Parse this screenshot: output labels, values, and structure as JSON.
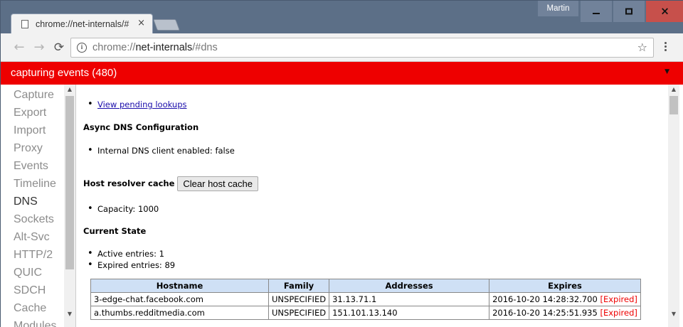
{
  "tab": {
    "title": "chrome://net-internals/#",
    "close": "×"
  },
  "user": "Martin",
  "window_controls": {
    "minimize": "minimize",
    "maximize": "maximize",
    "close": "×"
  },
  "toolbar": {
    "back": "←",
    "forward": "→",
    "reload": "⟳",
    "url_scheme": "chrome://",
    "url_host": "net-internals",
    "url_path": "/#dns",
    "star": "☆"
  },
  "capture_bar": {
    "text": "capturing events (480)",
    "dropdown": "▼"
  },
  "sidebar": {
    "items": [
      "Capture",
      "Export",
      "Import",
      "Proxy",
      "Events",
      "Timeline",
      "DNS",
      "Sockets",
      "Alt-Svc",
      "HTTP/2",
      "QUIC",
      "SDCH",
      "Cache",
      "Modules"
    ],
    "active": "DNS"
  },
  "content": {
    "pending_link": "View pending lookups",
    "async_heading": "Async DNS Configuration",
    "internal_dns": "Internal DNS client enabled: false",
    "host_cache_heading": "Host resolver cache",
    "clear_cache_button": "Clear host cache",
    "capacity": "Capacity: 1000",
    "current_state_heading": "Current State",
    "active_entries": "Active entries: 1",
    "expired_entries": "Expired entries: 89",
    "table": {
      "columns": [
        "Hostname",
        "Family",
        "Addresses",
        "Expires"
      ],
      "rows": [
        {
          "hostname": "3-edge-chat.facebook.com",
          "family": "UNSPECIFIED",
          "addresses": "31.13.71.1",
          "expires": "2016-10-20 14:28:32.700",
          "flag": "[Expired]"
        },
        {
          "hostname": "a.thumbs.redditmedia.com",
          "family": "UNSPECIFIED",
          "addresses": "151.101.13.140",
          "expires": "2016-10-20 14:25:51.935",
          "flag": "[Expired]"
        }
      ]
    }
  },
  "colors": {
    "capture_bar": "#ee0000",
    "table_header": "#cfe0f5",
    "expired": "#e00000",
    "link": "#1a0dab"
  }
}
